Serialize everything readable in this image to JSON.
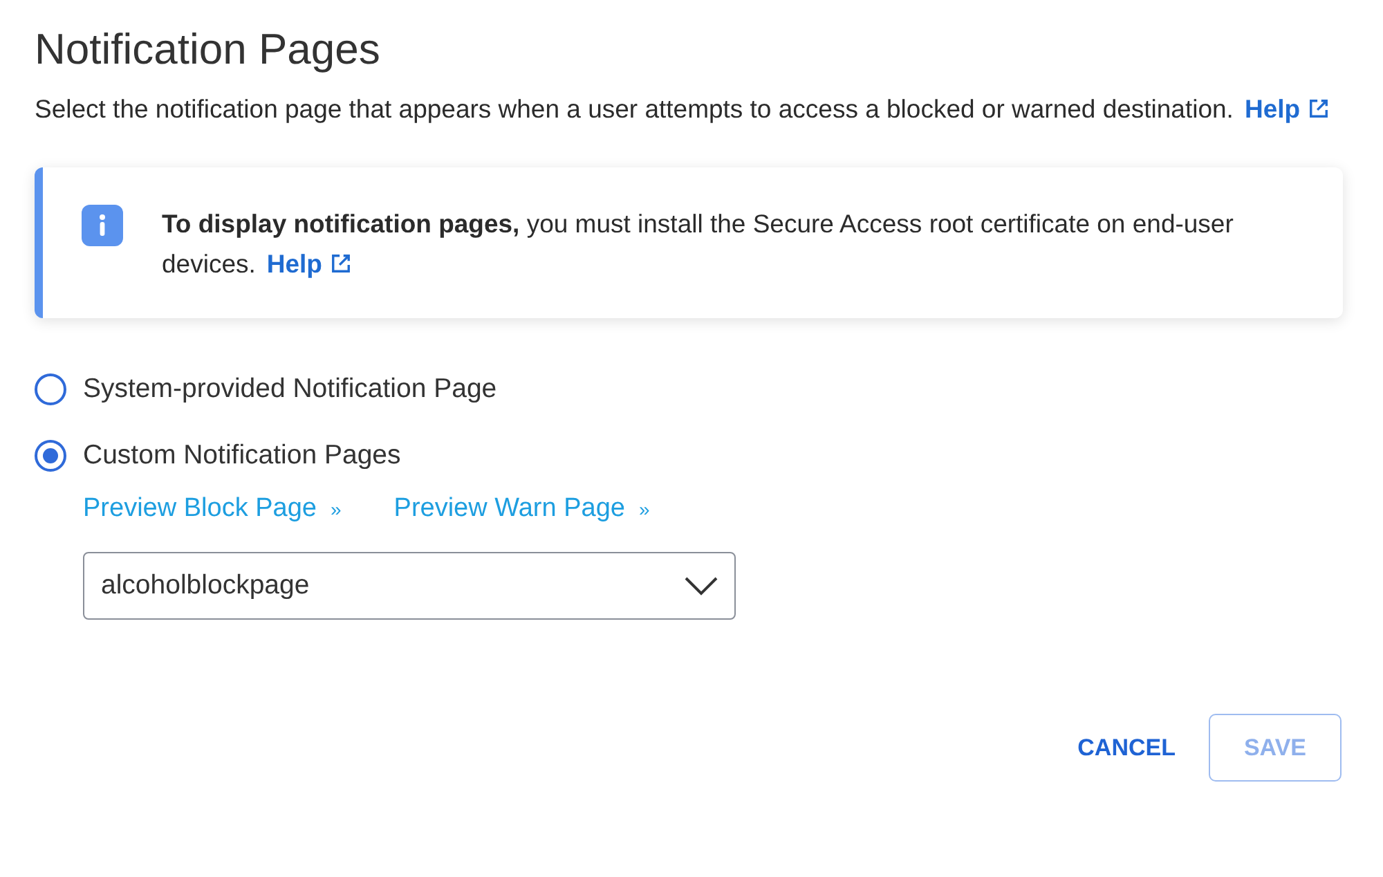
{
  "title": "Notification Pages",
  "description": {
    "text": "Select the notification page that appears when a user attempts to access a blocked or warned destination.",
    "link": "Help"
  },
  "callout": {
    "text": "**To display notification pages,** you must install the Secure Access root certificate on end-user devices.",
    "link": "Help"
  },
  "options": [
    {
      "label": "System-provided Notification Page",
      "selected": false
    },
    {
      "label": "Custom Notification Pages",
      "selected": true
    }
  ],
  "preview_links": [
    "Preview Block Page",
    "Preview Warn Page"
  ],
  "link_suffix": "»",
  "select": {
    "value": "alcoholblockpage"
  },
  "buttons": [
    {
      "label": "CANCEL",
      "kind": "text",
      "disabled": false
    },
    {
      "label": "SAVE",
      "kind": "outline",
      "disabled": true
    }
  ]
}
